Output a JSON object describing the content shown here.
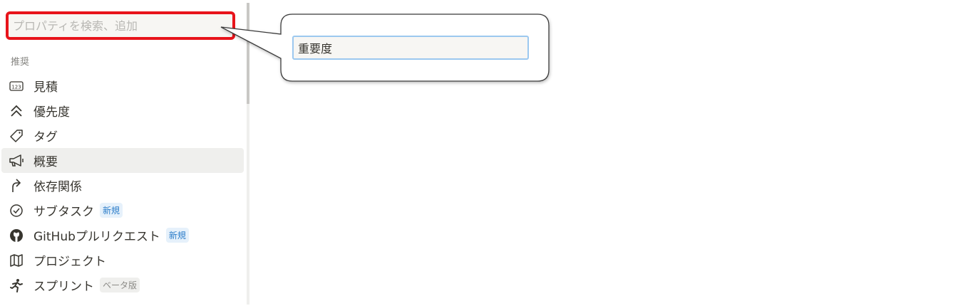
{
  "search": {
    "placeholder": "プロパティを検索、追加",
    "value": ""
  },
  "section": {
    "label": "推奨"
  },
  "menu": {
    "items": [
      {
        "label": "見積",
        "icon": "number-123-icon",
        "badge": ""
      },
      {
        "label": "優先度",
        "icon": "double-chevron-up-icon",
        "badge": ""
      },
      {
        "label": "タグ",
        "icon": "tag-icon",
        "badge": ""
      },
      {
        "label": "概要",
        "icon": "megaphone-icon",
        "badge": ""
      },
      {
        "label": "依存関係",
        "icon": "dependency-arrow-icon",
        "badge": ""
      },
      {
        "label": "サブタスク",
        "icon": "check-circle-icon",
        "badge": "新規"
      },
      {
        "label": "GitHubプルリクエスト",
        "icon": "github-icon",
        "badge": "新規"
      },
      {
        "label": "プロジェクト",
        "icon": "map-icon",
        "badge": ""
      },
      {
        "label": "スプリント",
        "icon": "running-person-icon",
        "badge": "ベータ版"
      }
    ]
  },
  "callout": {
    "value": "重要度"
  },
  "colors": {
    "highlight_border": "#e8141b",
    "input_focus_border": "#9cc8ef",
    "badge_new_bg": "#e6f1fb",
    "badge_new_text": "#2c7dc9",
    "badge_beta_bg": "#efefed",
    "active_row_bg": "#efefed"
  }
}
